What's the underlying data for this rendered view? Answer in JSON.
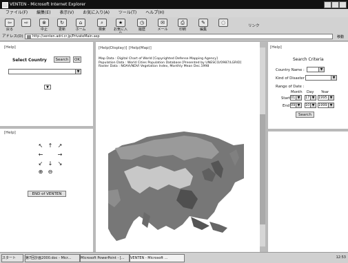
{
  "window": {
    "title": "VENTEN - Microsoft Internet Explorer"
  },
  "menu": [
    "ファイル(F)",
    "編集(E)",
    "表示(V)",
    "お気に入り(A)",
    "ツール(T)",
    "ヘルプ(H)"
  ],
  "toolbar": [
    {
      "label": "戻る",
      "icon": "back-icon",
      "glyph": "⇦"
    },
    {
      "label": "",
      "icon": "forward-icon",
      "glyph": "⇨"
    },
    {
      "label": "中止",
      "icon": "stop-icon",
      "glyph": "⊗"
    },
    {
      "label": "更新",
      "icon": "refresh-icon",
      "glyph": "↻"
    },
    {
      "label": "ホーム",
      "icon": "home-icon",
      "glyph": "⌂"
    },
    {
      "label": "検索",
      "icon": "search-icon",
      "glyph": "⌕"
    },
    {
      "label": "お気に入り",
      "icon": "favorites-icon",
      "glyph": "★"
    },
    {
      "label": "履歴",
      "icon": "history-icon",
      "glyph": "◷"
    },
    {
      "label": "メール",
      "icon": "mail-icon",
      "glyph": "✉"
    },
    {
      "label": "印刷",
      "icon": "print-icon",
      "glyph": "⎙"
    },
    {
      "label": "編集",
      "icon": "edit-icon",
      "glyph": "✎"
    },
    {
      "label": "",
      "icon": "discuss-icon",
      "glyph": "◌"
    }
  ],
  "links_label": "リンク",
  "address": {
    "label": "アドレス(D)",
    "url": "http://venten.adri.cr.jp/PrivateMain.asp",
    "go": "移動"
  },
  "left": {
    "help": "[Help]",
    "select_country": "Select Country",
    "search_btn": "Search",
    "ok_btn": "OK",
    "help2": "[Help]",
    "end_btn": "END of VENTEN"
  },
  "middle": {
    "help_display": "[Help(Display)]",
    "help_map": "[Help(Map)]",
    "map_data": "Map Data : Digital Chart of World [Copyrighted Defense Mapping Agency]",
    "population_data": "Population Data : World Cities Population Database [Presented by UNESCO/O987/LGRID]",
    "raster_data": "Raster Data : NOAA/NDVI Vegetation Index, Monthly Mean Dec.1998"
  },
  "right": {
    "help": "[Help]",
    "criteria_title": "Search Criteria",
    "country_label": "Country Name :",
    "disaster_label": "Kind of Disaster :",
    "range_label": "Range of Date :",
    "month": "Month",
    "day": "Day",
    "year": "Year",
    "start": "Start",
    "end": "End",
    "start_month": "01",
    "start_day": "17",
    "start_year": "1995",
    "end_month": "09",
    "end_day": "10",
    "end_year": "1999",
    "search": "Search"
  },
  "taskbar": {
    "start": "スタート",
    "items": [
      "第7回計画2000.doc - Micr...",
      "Microsoft PowerPoint - [...",
      "VENTEN - Microsoft ..."
    ],
    "clock": "12:53"
  }
}
